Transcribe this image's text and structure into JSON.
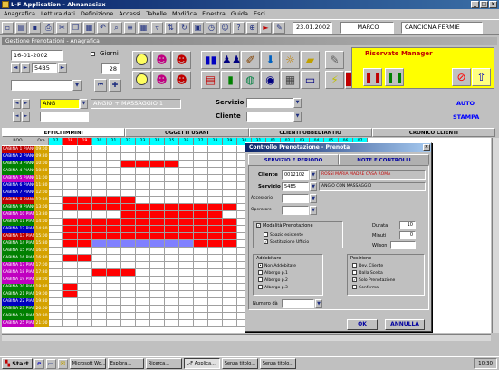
{
  "app": {
    "title": "L-F Application - Ahnanasiax"
  },
  "menu": [
    "Anagrafica",
    "Lettura dati",
    "Definizione",
    "Accessi",
    "Tabelle",
    "Modifica",
    "Finestra",
    "Guida",
    "Esci"
  ],
  "toolbar": {
    "date": "23.01.2002",
    "field2": "MARCO",
    "field3": "CANCIONA FERMIE"
  },
  "child": {
    "title": "Gestione Prenotazioni - Anagrafica"
  },
  "filters": {
    "date": "16-01-2002",
    "code": "54B5",
    "giorni_label": "Giorni",
    "giorni_value": "28",
    "ang_label": "ANG",
    "massaggio": "ANGIO + MASSAGGIO 1"
  },
  "fields": {
    "servizio_label": "Servizio",
    "cliente_label": "Cliente"
  },
  "yellow": {
    "title": "Riservate Manager"
  },
  "links": {
    "auto": "AUTO",
    "stampa": "STAMPA"
  },
  "tabs": [
    "EFFICI IMMINI",
    "OGGETTI USANI",
    "CLIENTI OBBEDIANTIO",
    "CRONICO CLIENTI"
  ],
  "grid": {
    "col_header": "ROO",
    "time_header": "Ora",
    "days": [
      "17",
      "18",
      "19",
      "20",
      "21",
      "22",
      "23",
      "24",
      "25",
      "26",
      "27",
      "28",
      "29",
      "30",
      "31",
      "01",
      "02",
      "03",
      "04",
      "05",
      "06",
      "07"
    ],
    "rows": [
      {
        "room": "CABINA 1 PIANO 1",
        "time": "09:00",
        "color": "#c00000"
      },
      {
        "room": "CABINA 2 PIANO 1",
        "time": "09:30",
        "color": "#0000c0"
      },
      {
        "room": "CABINA 3 PIANO 1",
        "time": "10:00",
        "color": "#008000"
      },
      {
        "room": "CABINA 4 PIANO 1",
        "time": "10:30",
        "color": "#008000"
      },
      {
        "room": "CABINA 5 PIANO 1",
        "time": "11:00",
        "color": "#c000c0"
      },
      {
        "room": "CABINA 6 PIANO 1",
        "time": "11:30",
        "color": "#0000c0"
      },
      {
        "room": "CABINA 7 PIANO 1",
        "time": "12:00",
        "color": "#0000c0"
      },
      {
        "room": "CABINA 8 PIANO 1",
        "time": "12:30",
        "color": "#c00000"
      },
      {
        "room": "CABINA 9 PIANO 1",
        "time": "13:00",
        "color": "#008000"
      },
      {
        "room": "CABINA 10 PIANO 1",
        "time": "13:30",
        "color": "#c000c0"
      },
      {
        "room": "CABINA 11 PIANO 1",
        "time": "14:00",
        "color": "#008000"
      },
      {
        "room": "CABINA 12 PIANO 1",
        "time": "14:30",
        "color": "#0000c0"
      },
      {
        "room": "CABINA 13 PIANO 1",
        "time": "15:00",
        "color": "#c00000"
      },
      {
        "room": "CABINA 14 PIANO 1",
        "time": "15:30",
        "color": "#008000"
      },
      {
        "room": "CABINA 15 PIANO 1",
        "time": "16:00",
        "color": "#008000"
      },
      {
        "room": "CABINA 16 PIANO 1",
        "time": "16:30",
        "color": "#008000"
      },
      {
        "room": "CABINA 17 PIANO 1",
        "time": "17:00",
        "color": "#c000c0"
      },
      {
        "room": "CABINA 18 PIANO 1",
        "time": "17:30",
        "color": "#c000c0"
      },
      {
        "room": "CABINA 19 PIANO 1",
        "time": "18:00",
        "color": "#c000c0"
      },
      {
        "room": "CABINA 20 PIANO 1",
        "time": "18:30",
        "color": "#008000"
      },
      {
        "room": "CABINA 21 PIANO 1",
        "time": "19:00",
        "color": "#008000"
      },
      {
        "room": "CABINA 22 PIANO 1",
        "time": "19:30",
        "color": "#0000c0"
      },
      {
        "room": "CABINA 23 PIANO 1",
        "time": "20:00",
        "color": "#008000"
      },
      {
        "room": "CABINA 24 PIANO 1",
        "time": "20:30",
        "color": "#008000"
      },
      {
        "room": "CABINA 25 PIANO 1",
        "time": "21:00",
        "color": "#c000c0"
      }
    ]
  },
  "dialog": {
    "title": "Controllo Prenotazione - Prenota",
    "tabs": [
      "SERVIZIO E PERIODO",
      "NOTE E CONTROLLI"
    ],
    "cliente_label": "Cliente",
    "cliente_code": "0012102",
    "cliente_name": "ROSSI MARIA MADRE CASA ROMA",
    "servizio_label": "Servizio",
    "servizio_code": "54B5",
    "servizio_name": "ANGIO CON MASSAGGIO",
    "accessorio_label": "Accessorio",
    "operatore_label": "Operatore",
    "modo_label": "Modalità Prenotazione",
    "opt1": "Spazio esistente",
    "opt2": "Sostituzione Ufficio",
    "durata_label": "Durata",
    "durata_value": "10",
    "minuti_label": "Minuti",
    "minuti_value": "0",
    "wilson_label": "Wilson",
    "addebito_label": "Addebitare",
    "addebito_opts": [
      "Non Addebitate",
      "Albergo p.1",
      "Albergo p.2",
      "Albergo p.3"
    ],
    "posizione_label": "Posizione",
    "posizione_opts": [
      "Dev. Cliente",
      "Dalla Scelta",
      "Solo Prenotazione",
      "Conferma"
    ],
    "numero_label": "Numero dà",
    "ok": "OK",
    "cancel": "ANNULLA"
  },
  "taskbar": {
    "start": "Start",
    "items": [
      "Microsoft Wo...",
      "Esplora...",
      "Ricerca...",
      "L-F Applica...",
      "Senza titolo...",
      "Senza titolo..."
    ],
    "clock": "10:30"
  }
}
